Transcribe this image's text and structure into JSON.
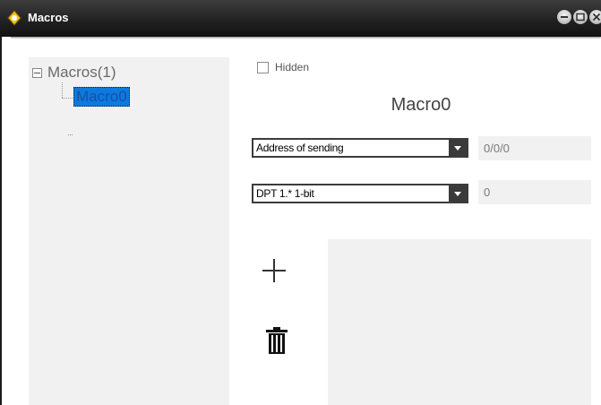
{
  "window": {
    "title": "Macros",
    "icon": "macro-app-icon",
    "controls": [
      "minimize-icon",
      "maximize-icon",
      "close-icon"
    ]
  },
  "tree": {
    "root_label": "Macros(1)",
    "root_state": "expanded",
    "children": [
      {
        "label": "Macro0",
        "selected": true
      }
    ]
  },
  "hidden_checkbox": {
    "label": "Hidden",
    "checked": false
  },
  "macro_name": "Macro0",
  "address_type": {
    "selected": "Address of sending"
  },
  "address_value": "0/0/0",
  "dpt_type": {
    "selected": "DPT 1.* 1-bit"
  },
  "dpt_value": "0",
  "actions": {
    "add_icon": "plus-icon",
    "delete_icon": "trash-icon"
  },
  "colors": {
    "titlebar": "#222222",
    "panel_bg": "#f1f1f1",
    "selection": "#0b7ae0",
    "text": "#444444"
  }
}
